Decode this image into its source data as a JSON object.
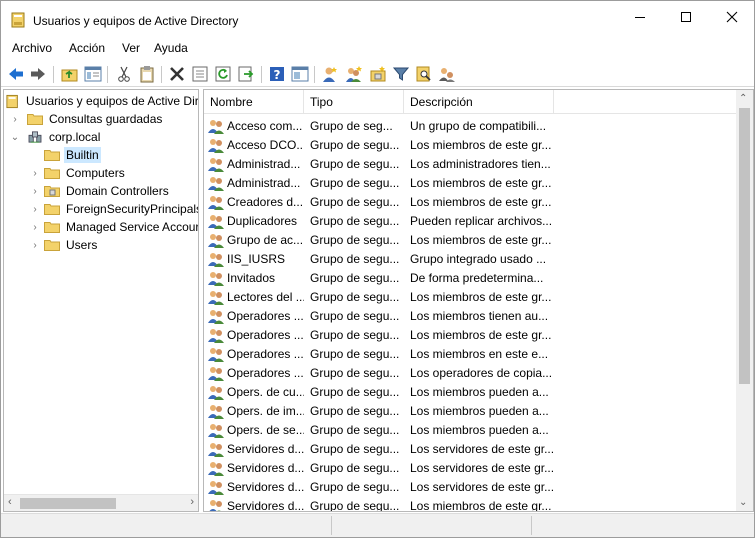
{
  "window": {
    "title": "Usuarios y equipos de Active Directory"
  },
  "menu": [
    "Archivo",
    "Acción",
    "Ver",
    "Ayuda"
  ],
  "toolbar_icons": [
    "back-arrow-icon",
    "forward-arrow-icon",
    "up-folder-icon",
    "show-tree-icon",
    "cut-icon",
    "clipboard-icon",
    "delete-icon",
    "properties-icon",
    "refresh-icon",
    "export-icon",
    "help-icon",
    "console-icon",
    "new-user-icon",
    "new-group-icon",
    "new-ou-icon",
    "filter-icon",
    "find-icon",
    "delegate-icon"
  ],
  "tree": {
    "root": "Usuarios y equipos de Active Dir",
    "saved_queries": "Consultas guardadas",
    "domain": "corp.local",
    "children": [
      "Builtin",
      "Computers",
      "Domain Controllers",
      "ForeignSecurityPrincipals",
      "Managed Service Accour",
      "Users"
    ],
    "selected": "Builtin"
  },
  "list": {
    "columns": [
      "Nombre",
      "Tipo",
      "Descripción"
    ],
    "rows": [
      {
        "name": "Acceso com...",
        "type": "Grupo de seg...",
        "desc": "Un grupo de compatibili..."
      },
      {
        "name": "Acceso DCO...",
        "type": "Grupo de segu...",
        "desc": "Los miembros de este gr..."
      },
      {
        "name": "Administrad...",
        "type": "Grupo de segu...",
        "desc": "Los administradores tien..."
      },
      {
        "name": "Administrad...",
        "type": "Grupo de segu...",
        "desc": "Los miembros de este gr..."
      },
      {
        "name": "Creadores d...",
        "type": "Grupo de segu...",
        "desc": "Los miembros de este gr..."
      },
      {
        "name": "Duplicadores",
        "type": "Grupo de segu...",
        "desc": "Pueden replicar archivos..."
      },
      {
        "name": "Grupo de ac...",
        "type": "Grupo de segu...",
        "desc": "Los miembros de este gr..."
      },
      {
        "name": "IIS_IUSRS",
        "type": "Grupo de segu...",
        "desc": "Grupo integrado usado ..."
      },
      {
        "name": "Invitados",
        "type": "Grupo de segu...",
        "desc": "De forma predetermina..."
      },
      {
        "name": "Lectores del ...",
        "type": "Grupo de segu...",
        "desc": "Los miembros de este gr..."
      },
      {
        "name": "Operadores ...",
        "type": "Grupo de segu...",
        "desc": "Los miembros tienen au..."
      },
      {
        "name": "Operadores ...",
        "type": "Grupo de segu...",
        "desc": "Los miembros de este gr..."
      },
      {
        "name": "Operadores ...",
        "type": "Grupo de segu...",
        "desc": "Los miembros en este e..."
      },
      {
        "name": "Operadores ...",
        "type": "Grupo de segu...",
        "desc": "Los operadores de copia..."
      },
      {
        "name": "Opers. de cu...",
        "type": "Grupo de segu...",
        "desc": "Los miembros pueden a..."
      },
      {
        "name": "Opers. de im...",
        "type": "Grupo de segu...",
        "desc": "Los miembros pueden a..."
      },
      {
        "name": "Opers. de se...",
        "type": "Grupo de segu...",
        "desc": "Los miembros pueden a..."
      },
      {
        "name": "Servidores d...",
        "type": "Grupo de segu...",
        "desc": "Los servidores de este gr..."
      },
      {
        "name": "Servidores d...",
        "type": "Grupo de segu...",
        "desc": "Los servidores de este gr..."
      },
      {
        "name": "Servidores d...",
        "type": "Grupo de segu...",
        "desc": "Los servidores de este gr..."
      },
      {
        "name": "Servidores d...",
        "type": "Grupo de segu...",
        "desc": "Los miembros de este gr..."
      }
    ]
  },
  "colors": {
    "selection": "#cce8ff",
    "arrow_blue": "#1e6fd0",
    "folder_yellow": "#f3d26a"
  }
}
